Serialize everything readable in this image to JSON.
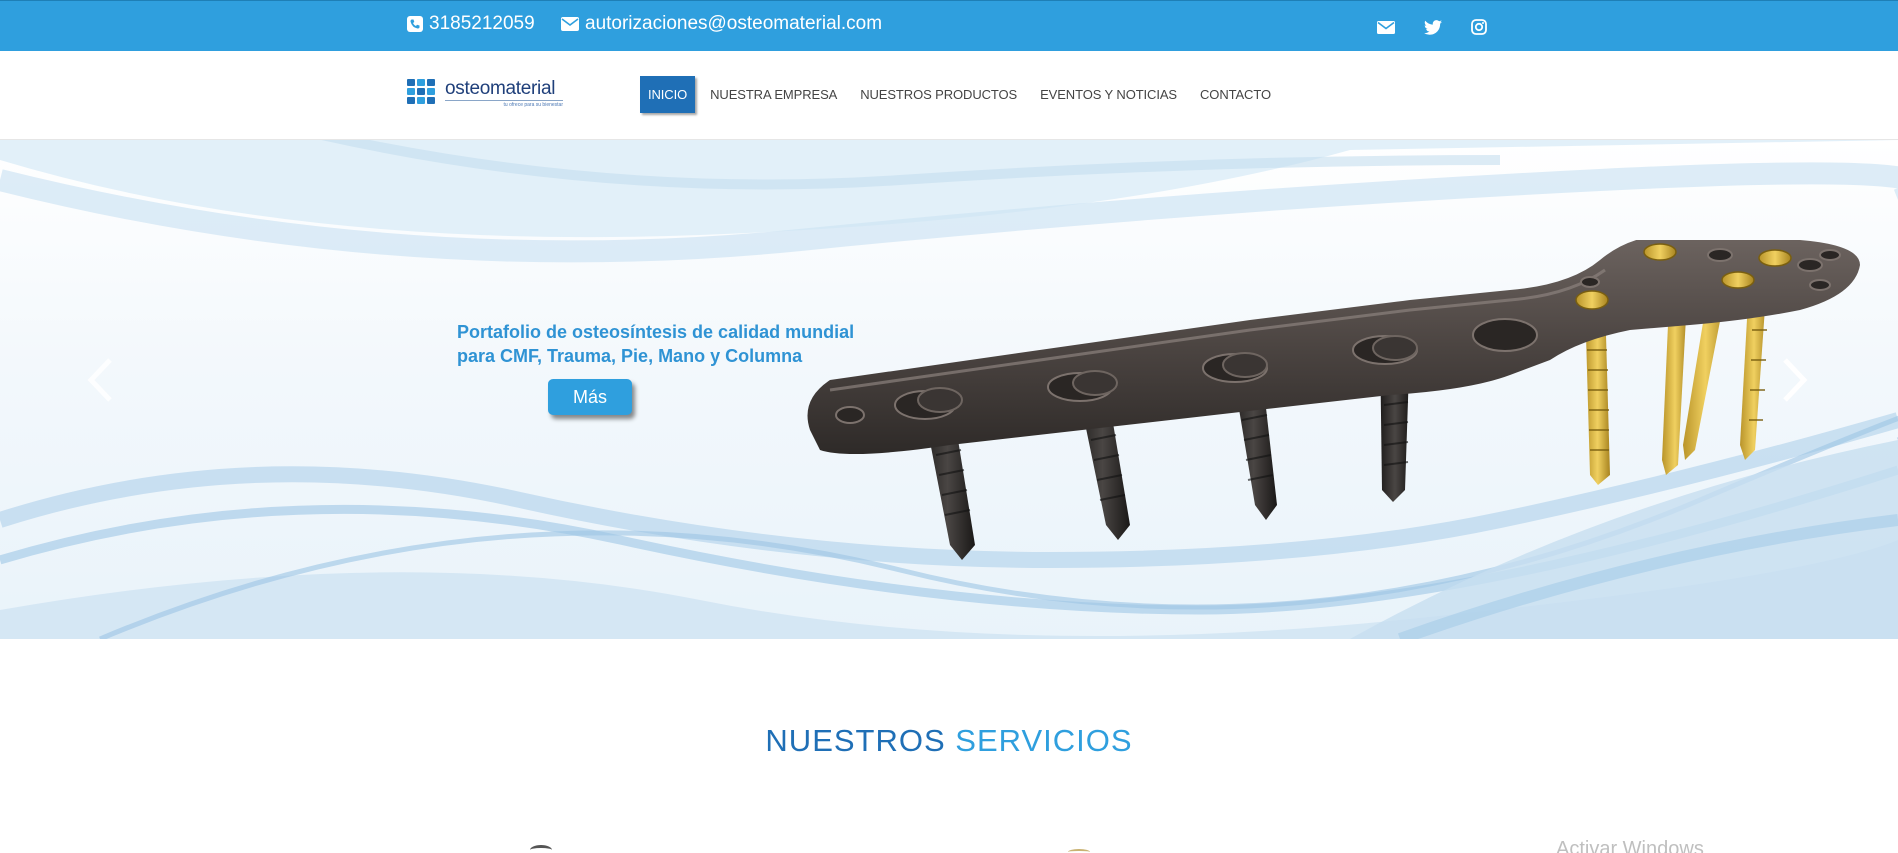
{
  "topbar": {
    "phone": "3185212059",
    "email": "autorizaciones@osteomaterial.com",
    "social": [
      "envelope-icon",
      "twitter-icon",
      "instagram-icon"
    ],
    "bg_color": "#2f9fde"
  },
  "logo": {
    "name": "osteomaterial",
    "tagline": "tu ofrece para su bienestar"
  },
  "nav": {
    "items": [
      {
        "label": "INICIO",
        "active": true
      },
      {
        "label": "NUESTRA EMPRESA"
      },
      {
        "label": "NUESTROS PRODUCTOS"
      },
      {
        "label": "EVENTOS Y NOTICIAS"
      },
      {
        "label": "CONTACTO"
      }
    ],
    "active_color": "#1f6fb6"
  },
  "hero": {
    "heading_line1": "Portafolio de osteosíntesis de calidad mundial",
    "heading_line2": "para CMF, Trauma, Pie, Mano y Columna",
    "button_label": "Más",
    "accent_color": "#2f93d4"
  },
  "services": {
    "title_part1": "NUESTROS",
    "title_part2": "SERVICIOS"
  },
  "overlay": {
    "watermark": "Activar Windows"
  }
}
